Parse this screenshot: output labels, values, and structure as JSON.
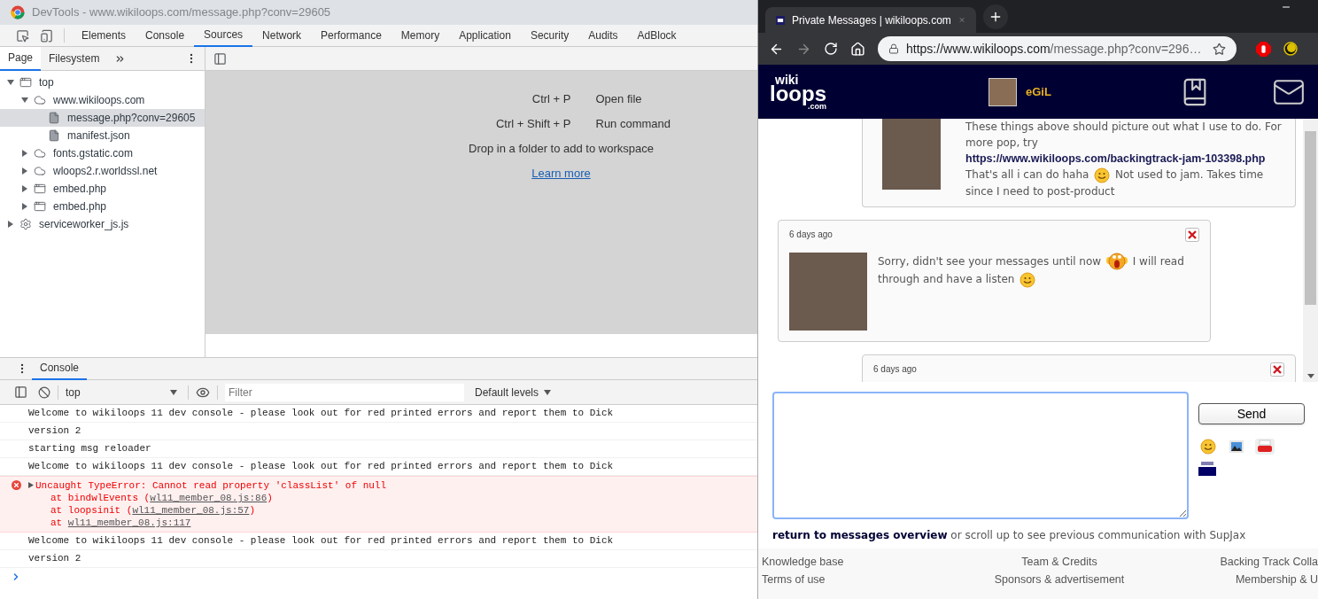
{
  "devtools": {
    "title": "DevTools - www.wikiloops.com/message.php?conv=29605",
    "tabs": [
      {
        "label": "Elements",
        "selected": false
      },
      {
        "label": "Console",
        "selected": false
      },
      {
        "label": "Sources",
        "selected": true
      },
      {
        "label": "Network",
        "selected": false
      },
      {
        "label": "Performance",
        "selected": false
      },
      {
        "label": "Memory",
        "selected": false
      },
      {
        "label": "Application",
        "selected": false
      },
      {
        "label": "Security",
        "selected": false
      },
      {
        "label": "Audits",
        "selected": false
      },
      {
        "label": "AdBlock",
        "selected": false
      }
    ],
    "navigator": {
      "tabs": [
        {
          "label": "Page",
          "selected": true
        },
        {
          "label": "Filesystem",
          "selected": false
        }
      ],
      "tree": [
        {
          "label": "top",
          "kind": "frame",
          "expanded": true,
          "selected": false,
          "children": [
            {
              "label": "www.wikiloops.com",
              "kind": "cloud",
              "expanded": true,
              "selected": false,
              "children": [
                {
                  "label": "message.php?conv=29605",
                  "kind": "file",
                  "selected": true
                },
                {
                  "label": "manifest.json",
                  "kind": "file",
                  "selected": false
                }
              ]
            },
            {
              "label": "fonts.gstatic.com",
              "kind": "cloud",
              "expanded": false,
              "selected": false
            },
            {
              "label": "wloops2.r.worldssl.net",
              "kind": "cloud",
              "expanded": false,
              "selected": false
            },
            {
              "label": "embed.php",
              "kind": "frame",
              "expanded": false,
              "selected": false
            },
            {
              "label": "embed.php",
              "kind": "frame",
              "expanded": false,
              "selected": false
            }
          ]
        },
        {
          "label": "serviceworker_js.js",
          "kind": "gear",
          "expanded": false,
          "selected": false
        }
      ]
    },
    "editor": {
      "shortcuts": [
        {
          "keys": "Ctrl + P",
          "action": "Open file"
        },
        {
          "keys": "Ctrl + Shift + P",
          "action": "Run command"
        }
      ],
      "hint": "Drop in a folder to add to workspace",
      "link": "Learn more"
    },
    "drawer": {
      "tabs": [
        {
          "label": "Console",
          "selected": true
        }
      ],
      "context": "top",
      "filter_placeholder": "Filter",
      "levels": "Default levels",
      "messages": [
        {
          "kind": "log",
          "text": "Welcome to wikiloops 11 dev console - please look out for red printed errors and report them to Dick"
        },
        {
          "kind": "log",
          "text": "version 2"
        },
        {
          "kind": "log",
          "text": "starting msg reloader"
        },
        {
          "kind": "log",
          "text": "Welcome to wikiloops 11 dev console - please look out for red printed errors and report them to Dick"
        },
        {
          "kind": "error",
          "text": "Uncaught TypeError: Cannot read property 'classList' of null",
          "stack": [
            {
              "prefix": "at bindwlEvents (",
              "source": "wl11_member_08.js:86",
              "suffix": ")"
            },
            {
              "prefix": "at loopsinit (",
              "source": "wl11_member_08.js:57",
              "suffix": ")"
            },
            {
              "prefix": "at ",
              "source": "wl11_member_08.js:117"
            }
          ]
        },
        {
          "kind": "log",
          "text": "Welcome to wikiloops 11 dev console - please look out for red printed errors and report them to Dick"
        },
        {
          "kind": "log",
          "text": "version 2"
        }
      ]
    }
  },
  "browser": {
    "tab": {
      "title": "Private Messages | wikiloops.com"
    },
    "address": {
      "host": "https://www.wikiloops.com",
      "path": "/message.php?conv=296…"
    },
    "site": {
      "logo": {
        "top": "wiki",
        "main": "loops",
        "sub": ".com"
      },
      "user": {
        "name": "eGiL"
      },
      "messages": [
        {
          "kind": "sent",
          "body": [
            {
              "kind": "text",
              "text": "These things above should picture out what I use to do. For more pop, try "
            },
            {
              "kind": "link",
              "text": "https://www.wikiloops.com/backingtrack-jam-103398.php"
            },
            {
              "kind": "text",
              "text": " That's all i can do haha "
            },
            {
              "kind": "smile"
            },
            {
              "kind": "text",
              "text": " Not used to jam. Takes time since I need to post-product"
            }
          ]
        },
        {
          "kind": "received",
          "date": "6 days ago",
          "body": [
            {
              "kind": "text",
              "text": "Sorry, didn't see your messages until now "
            },
            {
              "kind": "scream"
            },
            {
              "kind": "text",
              "text": " I will read through and have a listen "
            },
            {
              "kind": "smile"
            }
          ]
        },
        {
          "kind": "sent",
          "date": "6 days ago"
        }
      ],
      "compose": {
        "send": "Send"
      },
      "return_link": "return to messages overview",
      "return_text": " or scroll up to see previous communication with SupJax",
      "footer": {
        "columns": [
          [
            "Knowledge base",
            "Terms of use"
          ],
          [
            "Team & Credits",
            "Sponsors & advertisement"
          ],
          [
            "Backing Track Colla",
            "Membership & U"
          ]
        ]
      }
    }
  }
}
